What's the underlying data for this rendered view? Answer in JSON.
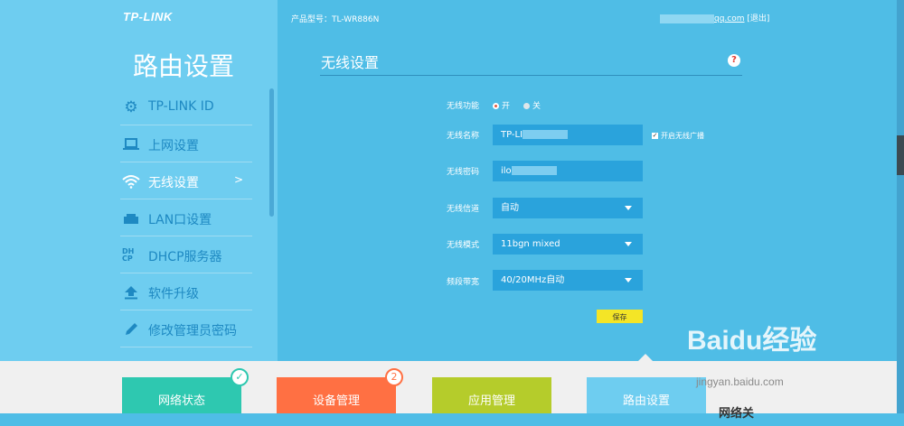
{
  "brand": "TP-LINK",
  "left_title": "路由设置",
  "nav": {
    "items": [
      {
        "label": "TP-LINK ID",
        "icon": "gear-icon"
      },
      {
        "label": "上网设置",
        "icon": "laptop-icon"
      },
      {
        "label": "无线设置",
        "icon": "wifi-icon",
        "active": true,
        "arrow": ">"
      },
      {
        "label": "LAN口设置",
        "icon": "lan-icon"
      },
      {
        "label": "DHCP服务器",
        "icon": "dhcp-icon",
        "icon_text": "DH CP"
      },
      {
        "label": "软件升级",
        "icon": "upload-icon"
      },
      {
        "label": "修改管理员密码",
        "icon": "pencil-icon"
      }
    ]
  },
  "header": {
    "model": "产品型号：TL-WR886N",
    "user_suffix": "qq.com",
    "logout": "[退出]"
  },
  "main": {
    "title": "无线设置",
    "help": "?",
    "wireless_function": {
      "label": "无线功能",
      "on": "开",
      "off": "关",
      "selected": "开"
    },
    "ssid": {
      "label": "无线名称",
      "value_prefix": "TP-LI",
      "broadcast_label": "开启无线广播",
      "broadcast_checked": true
    },
    "password": {
      "label": "无线密码",
      "value_prefix": "ilo"
    },
    "channel": {
      "label": "无线信道",
      "value": "自动"
    },
    "mode": {
      "label": "无线模式",
      "value": "11bgn mixed"
    },
    "bandwidth": {
      "label": "频段带宽",
      "value": "40/20MHz自动"
    },
    "save_label": "保存"
  },
  "bottom_tiles": [
    {
      "label": "网络状态",
      "color": "#2ec8b0",
      "badge": "✓"
    },
    {
      "label": "设备管理",
      "color": "#ff7043",
      "badge": "2"
    },
    {
      "label": "应用管理",
      "color": "#b5cc2b"
    },
    {
      "label": "路由设置",
      "color": "#6ecdf0"
    }
  ],
  "bottom_partial_text": "网络关",
  "watermark": {
    "text": "Baidu经验",
    "url": "jingyan.baidu.com"
  },
  "colors": {
    "bg": "#4fbde6",
    "sidebar": "#6ecdf0",
    "accent": "#1e89c2",
    "save": "#f4e526"
  }
}
